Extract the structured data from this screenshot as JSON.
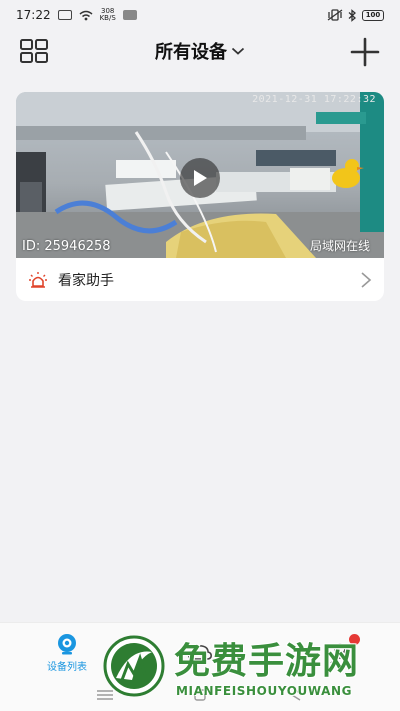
{
  "status_bar": {
    "time": "17:22",
    "net_speed_value": "308",
    "net_speed_unit": "KB/S",
    "battery": "100"
  },
  "header": {
    "title": "所有设备"
  },
  "device": {
    "timestamp": "2021-12-31  17:22:32",
    "id_text": "ID: 25946258",
    "status": "局域网在线",
    "assistant_label": "看家助手"
  },
  "bottom_nav": {
    "items": [
      {
        "label": "设备列表",
        "active": true
      }
    ]
  },
  "colors": {
    "accent": "#1a96e0",
    "alarm": "#e0452c",
    "watermark": "#3a8f3d"
  },
  "watermark": {
    "title": "免费手游网",
    "subtitle": "MIANFEISHOUYOUWANG"
  }
}
